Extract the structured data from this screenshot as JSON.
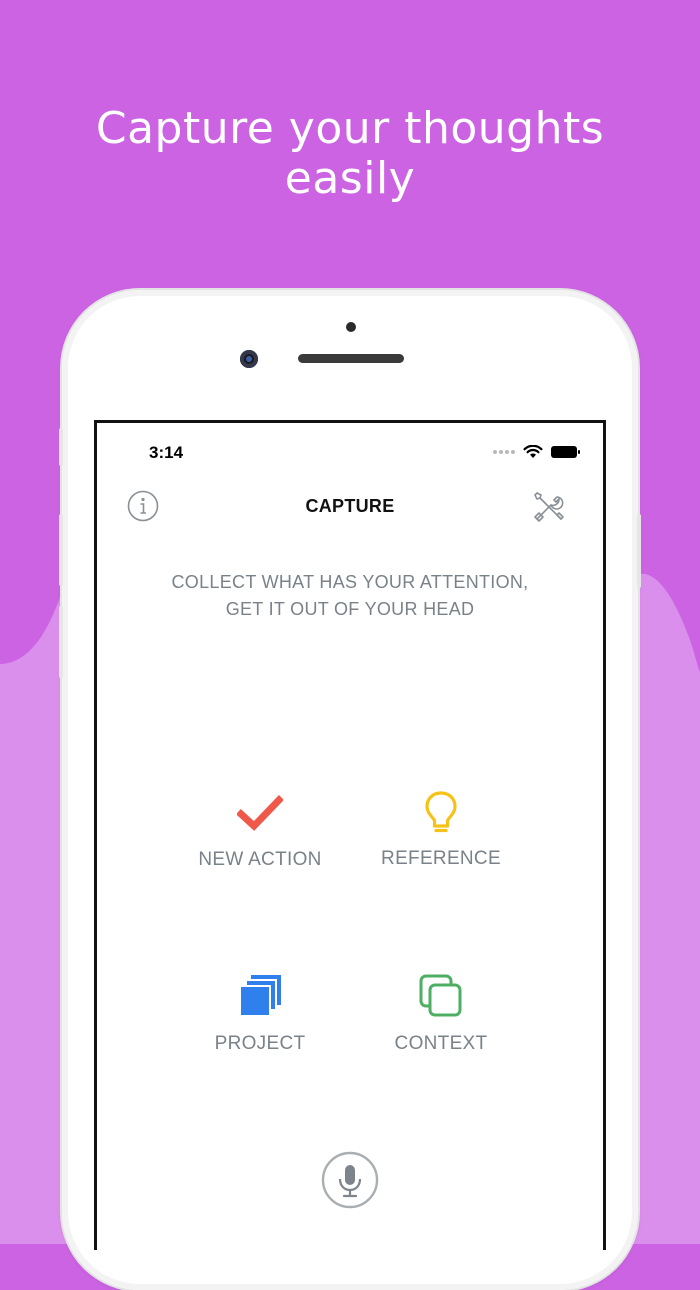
{
  "headline": {
    "line1": "Capture your thoughts",
    "line2": "easily"
  },
  "status_bar": {
    "time": "3:14"
  },
  "nav": {
    "title": "CAPTURE",
    "left_icon": "info-icon",
    "right_icon": "tools-icon"
  },
  "subtitle": {
    "line1": "COLLECT WHAT HAS YOUR ATTENTION,",
    "line2": "GET IT OUT OF YOUR HEAD"
  },
  "actions": [
    {
      "label": "NEW ACTION",
      "icon": "checkmark-icon",
      "color": "#f0584a"
    },
    {
      "label": "REFERENCE",
      "icon": "lightbulb-icon",
      "color": "#f7c218"
    },
    {
      "label": "PROJECT",
      "icon": "stacked-squares-icon",
      "color": "#2f80ed"
    },
    {
      "label": "CONTEXT",
      "icon": "overlapping-squares-icon",
      "color": "#4caf62"
    }
  ],
  "voice": {
    "icon": "microphone-icon"
  },
  "colors": {
    "background": "#cb63e3",
    "background_light": "#db8fec",
    "subtitle_text": "#7a8289"
  }
}
